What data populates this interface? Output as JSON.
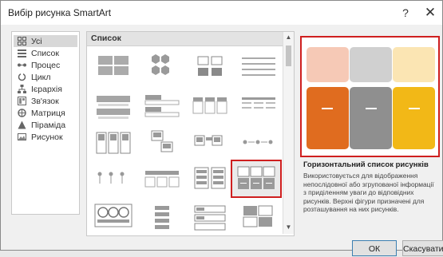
{
  "dialog": {
    "title": "Вибір рисунка SmartArt",
    "help": "?",
    "close": "✕"
  },
  "categories": [
    {
      "label": "Усі",
      "icon": "all-icon",
      "selected": true
    },
    {
      "label": "Список",
      "icon": "list-icon"
    },
    {
      "label": "Процес",
      "icon": "process-icon"
    },
    {
      "label": "Цикл",
      "icon": "cycle-icon"
    },
    {
      "label": "Ієрархія",
      "icon": "hierarchy-icon"
    },
    {
      "label": "Зв'язок",
      "icon": "relationship-icon"
    },
    {
      "label": "Матриця",
      "icon": "matrix-icon"
    },
    {
      "label": "Піраміда",
      "icon": "pyramid-icon"
    },
    {
      "label": "Рисунок",
      "icon": "picture-icon"
    }
  ],
  "gallery": {
    "header": "Список",
    "selected_layout": "Горизонтальний список рисунків"
  },
  "details": {
    "title": "Горизонтальний список рисунків",
    "description": "Використовується для відображення непослідовної або згрупованої інформації з приділенням уваги до відповідних рисунків. Верхні фігури призначені для розташування на них рисунків."
  },
  "colors": {
    "accent": "#cf1f1f",
    "peach": "#f6c9b6",
    "light_gray": "#d0d0d0",
    "light_yellow": "#fbe5b3",
    "orange": "#e06c1f",
    "gray": "#8f8f8f",
    "gold": "#f2b817"
  },
  "buttons": {
    "ok": "ОК",
    "cancel": "Скасувати"
  }
}
